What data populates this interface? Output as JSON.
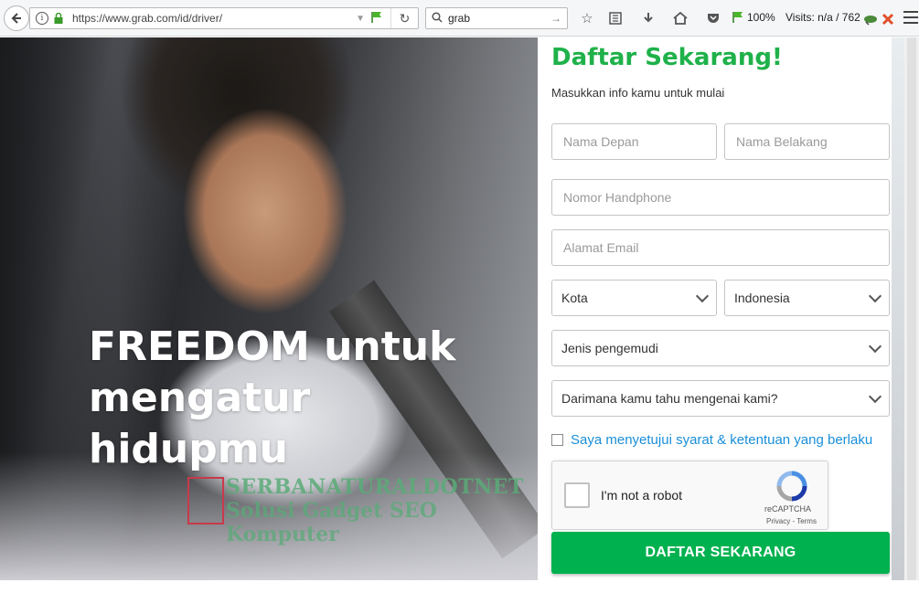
{
  "browser": {
    "url": "https://www.grab.com/id/driver/",
    "search_value": "grab",
    "zoom": "100%",
    "visits": "Visits: n/a / 762"
  },
  "hero": {
    "title": "FREEDOM untuk mengatur hidupmu",
    "watermark_line1": "SERBANATURALDOTNET",
    "watermark_line2": "Solusi Gadget SEO Komputer"
  },
  "form": {
    "title": "Daftar Sekarang!",
    "subtitle": "Masukkan info kamu untuk mulai",
    "first_name_placeholder": "Nama Depan",
    "last_name_placeholder": "Nama Belakang",
    "phone_placeholder": "Nomor Handphone",
    "email_placeholder": "Alamat Email",
    "city_select": "Kota",
    "country_select": "Indonesia",
    "driver_type_select": "Jenis pengemudi",
    "source_select": "Darimana kamu tahu mengenai kami?",
    "agree_label": "Saya menyetujui syarat & ketentuan yang berlaku",
    "recaptcha_label": "I'm not a robot",
    "recaptcha_brand": "reCAPTCHA",
    "recaptcha_links": "Privacy - Terms",
    "submit_label": "DAFTAR SEKARANG"
  },
  "colors": {
    "brand_green": "#00b14f",
    "title_green": "#1fb14a",
    "link_blue": "#1a8fd9"
  }
}
